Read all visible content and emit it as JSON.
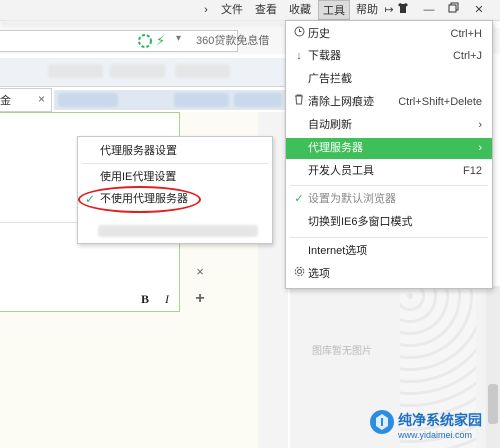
{
  "menubar": {
    "items": [
      "文件",
      "查看",
      "收藏",
      "工具",
      "帮助"
    ],
    "chevron": "›"
  },
  "addressbar": {
    "search_text": "360贷款免息借"
  },
  "tab": {
    "close": "×"
  },
  "tools_menu": {
    "items": [
      {
        "label": "历史",
        "shortcut": "Ctrl+H",
        "icon": "clock-icon"
      },
      {
        "label": "下载器",
        "shortcut": "Ctrl+J",
        "icon": "download-icon"
      },
      {
        "label": "广告拦截",
        "shortcut": "",
        "icon": ""
      },
      {
        "label": "清除上网痕迹",
        "shortcut": "Ctrl+Shift+Delete",
        "icon": "trash-icon"
      },
      {
        "label": "自动刷新",
        "shortcut": "›",
        "icon": ""
      },
      {
        "label": "代理服务器",
        "shortcut": "›",
        "icon": "",
        "highlighted": true
      },
      {
        "label": "开发人员工具",
        "shortcut": "F12",
        "icon": ""
      },
      {
        "label": "设置为默认浏览器",
        "shortcut": "",
        "icon": "check-icon",
        "disabled": true
      },
      {
        "label": "切换到IE6多窗口模式",
        "shortcut": "",
        "icon": ""
      },
      {
        "label": "Internet选项",
        "shortcut": "",
        "icon": ""
      },
      {
        "label": "选项",
        "shortcut": "",
        "icon": "gear-icon"
      }
    ],
    "highlight_color": "#3fbf5a"
  },
  "proxy_menu": {
    "items": [
      {
        "label": "代理服务器设置",
        "checked": false
      },
      {
        "label": "使用IE代理设置",
        "checked": false
      },
      {
        "label": "不使用代理服务器",
        "checked": true
      }
    ],
    "check_color": "#2db55d",
    "annotation_color": "#e02020"
  },
  "editor": {
    "bold": "B",
    "italic": "I",
    "close": "×",
    "add": "+"
  },
  "page": {
    "empty_image_text": "图库暂无图片"
  },
  "watermark": {
    "title": "纯净系统家园",
    "url": "www.yidaimei.com"
  }
}
